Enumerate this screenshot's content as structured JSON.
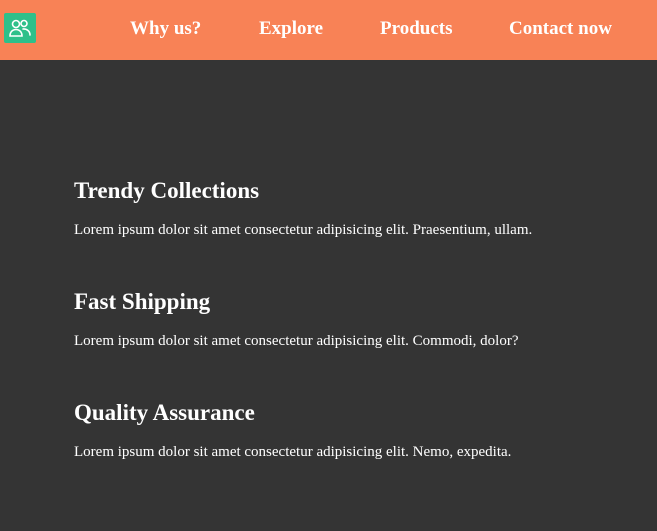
{
  "header": {
    "logo_icon": "users-icon",
    "nav": [
      {
        "label": "Why us?"
      },
      {
        "label": "Explore"
      },
      {
        "label": "Products"
      },
      {
        "label": "Contact now"
      }
    ]
  },
  "features": [
    {
      "title": "Trendy Collections",
      "text": "Lorem ipsum dolor sit amet consectetur adipisicing elit. Praesentium, ullam."
    },
    {
      "title": "Fast Shipping",
      "text": "Lorem ipsum dolor sit amet consectetur adipisicing elit. Commodi, dolor?"
    },
    {
      "title": "Quality Assurance",
      "text": "Lorem ipsum dolor sit amet consectetur adipisicing elit. Nemo, expedita."
    }
  ],
  "colors": {
    "header_bg": "#F88256",
    "page_bg": "#343434",
    "logo_bg": "#2EC08A",
    "text": "#FFFFFF"
  }
}
